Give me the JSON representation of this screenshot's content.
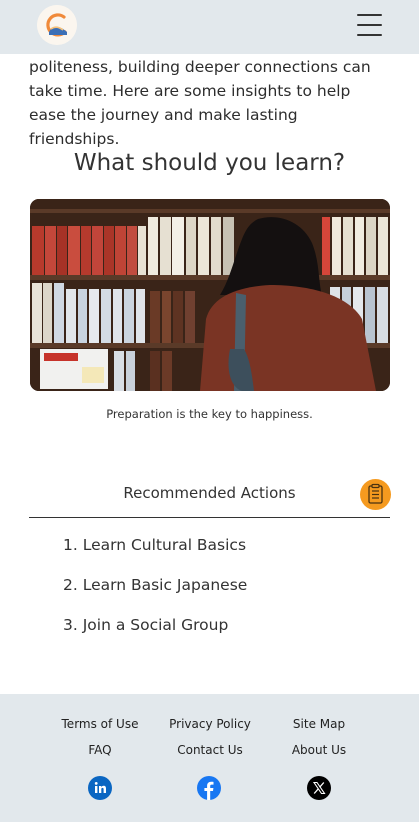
{
  "header": {
    "logo": "logo",
    "menu_icon": "hamburger-menu-icon"
  },
  "intro": {
    "text": "politeness, building deeper connections can take time. Here are some insights to help ease the journey and make lasting friendships."
  },
  "learn_section": {
    "title": "What should you learn?",
    "caption": "Preparation is the key to happiness."
  },
  "recommended": {
    "title": "Recommended Actions",
    "icon": "clipboard-icon",
    "items": [
      "1. Learn Cultural Basics",
      "2. Learn Basic Japanese",
      "3. Join a Social Group"
    ]
  },
  "footer": {
    "links_row1": [
      "Terms of Use",
      "Privacy Policy",
      "Site Map"
    ],
    "links_row2": [
      "FAQ",
      "Contact Us",
      "About Us"
    ],
    "social_icons": [
      "linkedin-icon",
      "facebook-icon",
      "x-icon"
    ]
  },
  "colors": {
    "bar_background": "#e2e8ec",
    "accent_orange": "#f59a1f",
    "linkedin_blue": "#0a66c2",
    "facebook_blue": "#1877f2"
  }
}
